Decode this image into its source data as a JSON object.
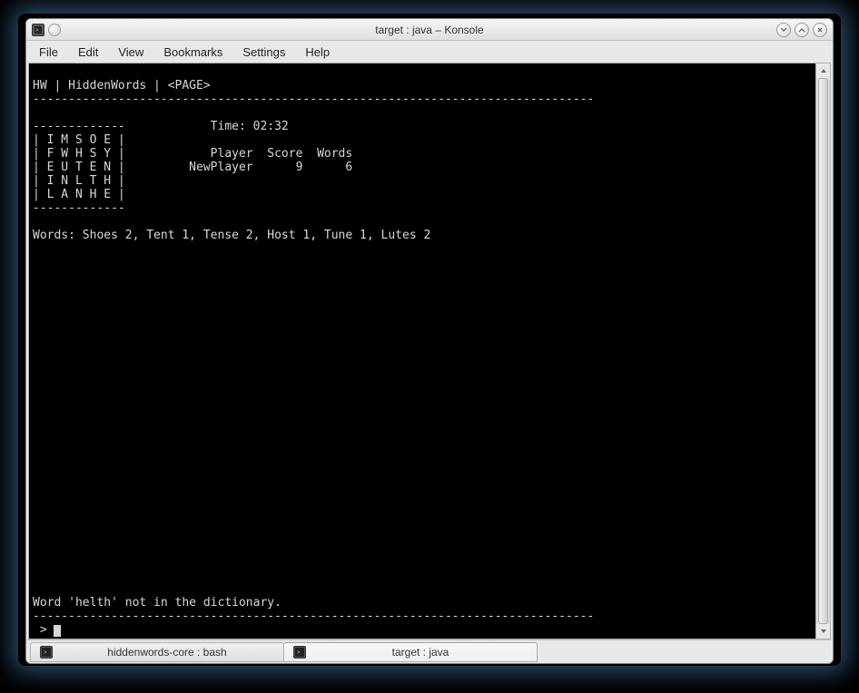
{
  "window": {
    "title": "target : java – Konsole"
  },
  "menubar": {
    "file": "File",
    "edit": "Edit",
    "view": "View",
    "bookmarks": "Bookmarks",
    "settings": "Settings",
    "help": "Help"
  },
  "terminal": {
    "header_line": "HW | HiddenWords | <PAGE>",
    "dash_top": "-------------------------------------------------------------------------------",
    "time_line": "-------------            Time: 02:32",
    "grid_row1": "| I M S O E |",
    "grid_row2": "| F W H S Y |            Player  Score  Words",
    "grid_row3": "| E U T E N |         NewPlayer      9      6",
    "grid_row4": "| I N L T H |",
    "grid_row5": "| L A N H E |",
    "grid_bottom": "-------------",
    "words_line": "Words: Shoes 2, Tent 1, Tense 2, Host 1, Tune 1, Lutes 2",
    "feedback": "Word 'helth' not in the dictionary.",
    "dash_bottom": "-------------------------------------------------------------------------------",
    "prompt": " > "
  },
  "tabs": {
    "tab1": "hiddenwords-core : bash",
    "tab2": "target : java"
  },
  "game": {
    "time": "02:32",
    "grid": [
      [
        "I",
        "M",
        "S",
        "O",
        "E"
      ],
      [
        "F",
        "W",
        "H",
        "S",
        "Y"
      ],
      [
        "E",
        "U",
        "T",
        "E",
        "N"
      ],
      [
        "I",
        "N",
        "L",
        "T",
        "H"
      ],
      [
        "L",
        "A",
        "N",
        "H",
        "E"
      ]
    ],
    "players": [
      {
        "name": "NewPlayer",
        "score": 9,
        "words": 6
      }
    ],
    "found_words": [
      {
        "word": "Shoes",
        "value": 2
      },
      {
        "word": "Tent",
        "value": 1
      },
      {
        "word": "Tense",
        "value": 2
      },
      {
        "word": "Host",
        "value": 1
      },
      {
        "word": "Tune",
        "value": 1
      },
      {
        "word": "Lutes",
        "value": 2
      }
    ],
    "last_error": "Word 'helth' not in the dictionary."
  }
}
